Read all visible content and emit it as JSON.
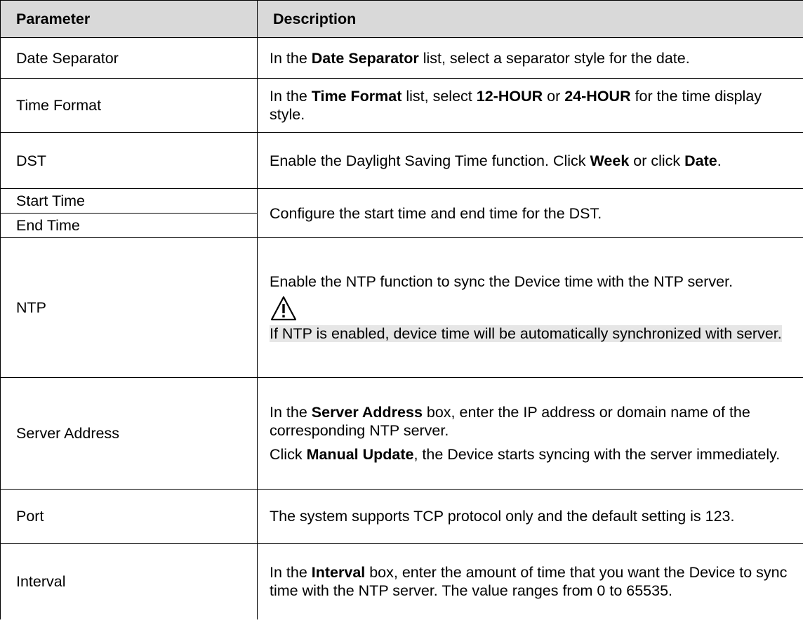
{
  "table": {
    "headers": {
      "parameter": "Parameter",
      "description": "Description"
    },
    "rows": {
      "date_separator": {
        "param": "Date Separator",
        "desc": {
          "a": "In the ",
          "b": "Date Separator",
          "c": " list, select a separator style for the date."
        }
      },
      "time_format": {
        "param": "Time Format",
        "desc": {
          "a": "In the ",
          "b": "Time Format",
          "c": " list, select ",
          "d": "12-HOUR",
          "e": " or ",
          "f": "24-HOUR",
          "g": " for the time display style."
        }
      },
      "dst": {
        "param": "DST",
        "desc": {
          "a": "Enable the Daylight Saving Time function. Click ",
          "b": "Week",
          "c": " or click ",
          "d": "Date",
          "e": "."
        }
      },
      "start_time": {
        "param": "Start Time"
      },
      "end_time": {
        "param": "End Time"
      },
      "start_end_desc": "Configure the start time and end time for the DST.",
      "ntp": {
        "param": "NTP",
        "desc": "Enable the NTP function to sync the Device time with the NTP server.",
        "note_icon": "warning-triangle-icon",
        "note": "If NTP is enabled, device time will be automatically synchronized with server."
      },
      "server_address": {
        "param": "Server Address",
        "desc1": {
          "a": "In the ",
          "b": "Server Address",
          "c": " box, enter the IP address or domain name of the corresponding NTP server."
        },
        "desc2": {
          "a": "Click ",
          "b": "Manual Update",
          "c": ", the Device starts syncing with the server immediately."
        }
      },
      "port": {
        "param": "Port",
        "desc": "The system supports TCP protocol only and the default setting is 123."
      },
      "interval": {
        "param": "Interval",
        "desc": {
          "a": "In the ",
          "b": "Interval",
          "c": " box, enter the amount of time that you want the Device to sync time with the NTP server. The value ranges from 0 to 65535."
        }
      }
    }
  },
  "colors": {
    "header_bg": "#d9d9d9",
    "note_highlight": "#e6e6e6",
    "border": "#000000"
  }
}
